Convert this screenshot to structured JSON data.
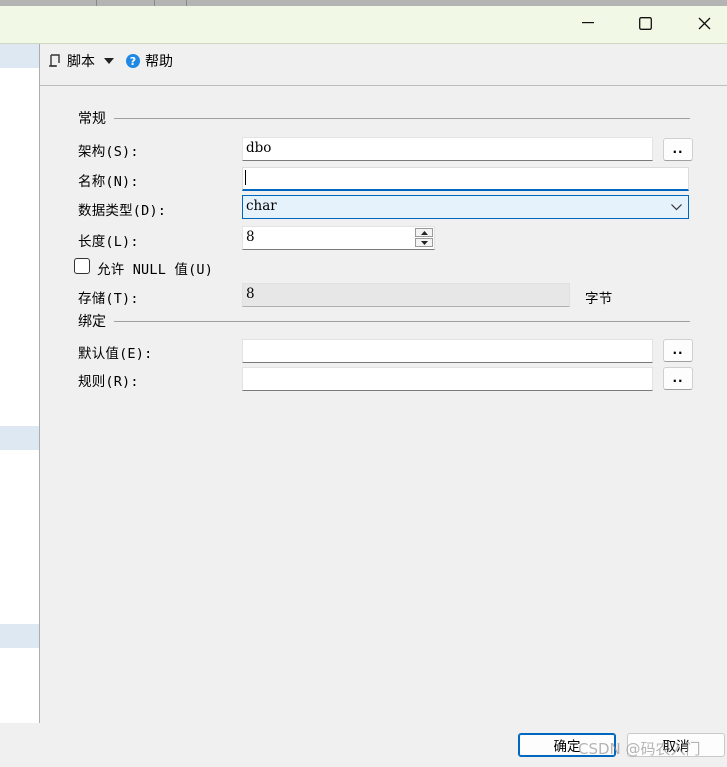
{
  "window": {
    "minimize_glyph": "—",
    "maximize_glyph": "☐",
    "close_glyph": "✕"
  },
  "toolbar": {
    "script_label": "脚本",
    "help_label": "帮助"
  },
  "sections": {
    "general": "常规",
    "binding": "绑定"
  },
  "form": {
    "schema": {
      "label": "架构(S):",
      "value": "dbo",
      "browse": ".."
    },
    "name": {
      "label": "名称(N):",
      "value": ""
    },
    "data_type": {
      "label": "数据类型(D):",
      "value": "char"
    },
    "length": {
      "label": "长度(L):",
      "value": "8"
    },
    "allow_null": {
      "label": "允许 NULL 值(U)",
      "checked": false
    },
    "storage": {
      "label": "存储(T):",
      "value": "8",
      "unit": "字节"
    },
    "default": {
      "label": "默认值(E):",
      "value": "",
      "browse": ".."
    },
    "rule": {
      "label": "规则(R):",
      "value": "",
      "browse": ".."
    }
  },
  "buttons": {
    "ok": "确定",
    "cancel": "取消"
  },
  "watermark": "CSDN @码农入门",
  "colors": {
    "accent": "#0067c0",
    "titlebar": "#f2f8e6",
    "help_icon": "#1e88e5"
  }
}
